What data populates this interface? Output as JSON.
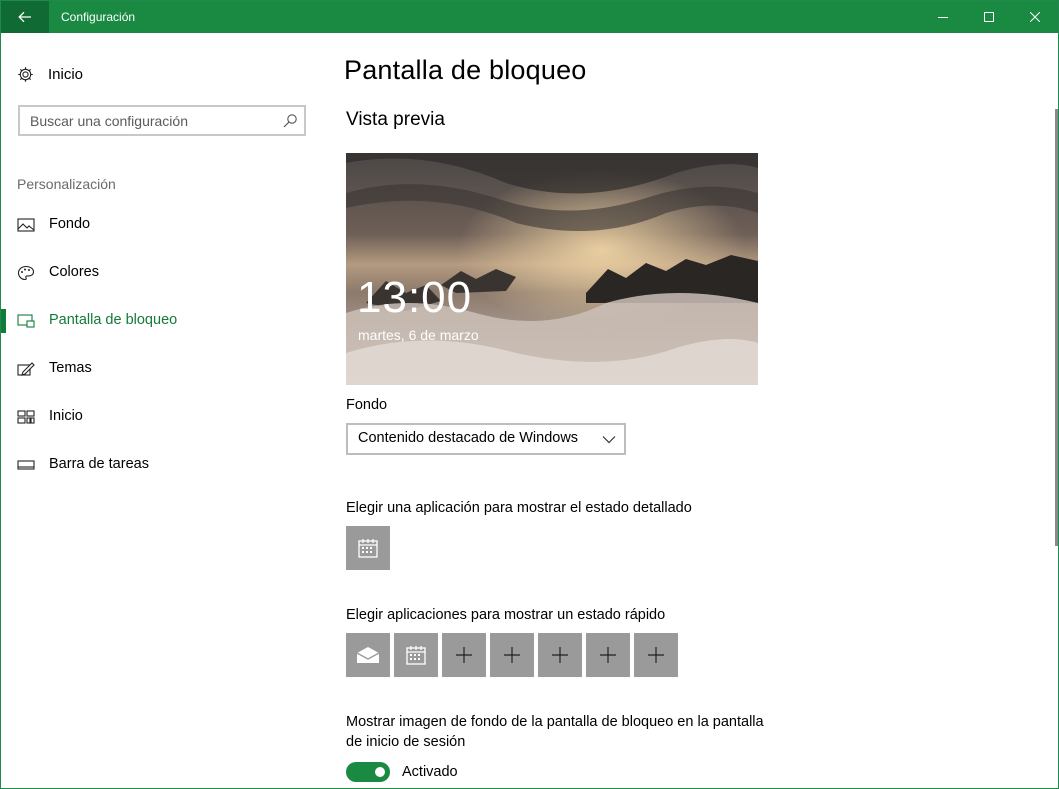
{
  "window": {
    "title": "Configuración"
  },
  "sidebar": {
    "home_label": "Inicio",
    "search_placeholder": "Buscar una configuración",
    "section_title": "Personalización",
    "items": [
      {
        "label": "Fondo",
        "icon": "picture-icon",
        "active": false
      },
      {
        "label": "Colores",
        "icon": "palette-icon",
        "active": false
      },
      {
        "label": "Pantalla de bloqueo",
        "icon": "lock-screen-icon",
        "active": true
      },
      {
        "label": "Temas",
        "icon": "themes-icon",
        "active": false
      },
      {
        "label": "Inicio",
        "icon": "start-icon",
        "active": false
      },
      {
        "label": "Barra de tareas",
        "icon": "taskbar-icon",
        "active": false
      }
    ]
  },
  "main": {
    "title": "Pantalla de bloqueo",
    "preview_heading": "Vista previa",
    "preview": {
      "time": "13:00",
      "date": "martes, 6 de marzo"
    },
    "background_label": "Fondo",
    "background_value": "Contenido destacado de Windows",
    "detailed_status_label": "Elegir una aplicación para mostrar el estado detallado",
    "detailed_status_app": "calendar-icon",
    "quick_status_label": "Elegir aplicaciones para mostrar un estado rápido",
    "quick_status_apps": [
      "mail-icon",
      "calendar-icon",
      "plus-icon",
      "plus-icon",
      "plus-icon",
      "plus-icon",
      "plus-icon"
    ],
    "signin_bg_label_line1": "Mostrar imagen de fondo de la pantalla de bloqueo en la pantalla",
    "signin_bg_label_line2": "de inicio de sesión",
    "signin_bg_toggle": "Activado",
    "signin_bg_on": true
  },
  "colors": {
    "accent": "#1a8a43",
    "active_nav": "#137a3a",
    "tile": "#9a9a9a"
  }
}
